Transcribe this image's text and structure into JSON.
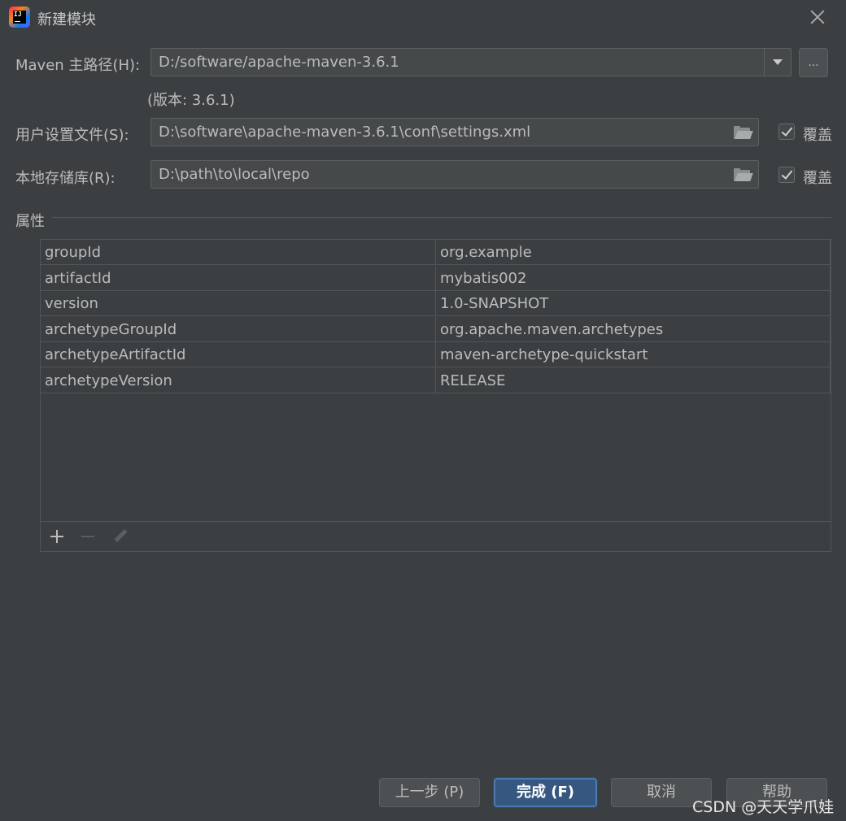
{
  "window": {
    "title": "新建模块"
  },
  "maven_home": {
    "label": "Maven 主路径(H):",
    "value": "D:/software/apache-maven-3.6.1",
    "browse_label": "...",
    "version_text": "(版本: 3.6.1)"
  },
  "user_settings": {
    "label": "用户设置文件(S):",
    "value": "D:\\software\\apache-maven-3.6.1\\conf\\settings.xml",
    "override_label": "覆盖",
    "override_checked": true
  },
  "local_repo": {
    "label": "本地存储库(R):",
    "value": "D:\\path\\to\\local\\repo",
    "override_label": "覆盖",
    "override_checked": true
  },
  "properties": {
    "title": "属性",
    "rows": [
      {
        "key": "groupId",
        "value": "org.example"
      },
      {
        "key": "artifactId",
        "value": "mybatis002"
      },
      {
        "key": "version",
        "value": "1.0-SNAPSHOT"
      },
      {
        "key": "archetypeGroupId",
        "value": "org.apache.maven.archetypes"
      },
      {
        "key": "archetypeArtifactId",
        "value": "maven-archetype-quickstart"
      },
      {
        "key": "archetypeVersion",
        "value": "RELEASE"
      }
    ],
    "toolbar_icons": [
      "add-icon",
      "remove-icon",
      "edit-icon"
    ]
  },
  "buttons": {
    "previous": "上一步 (P)",
    "finish": "完成 (F)",
    "cancel": "取消",
    "help": "帮助"
  },
  "watermark": "CSDN @天天学爪娃"
}
